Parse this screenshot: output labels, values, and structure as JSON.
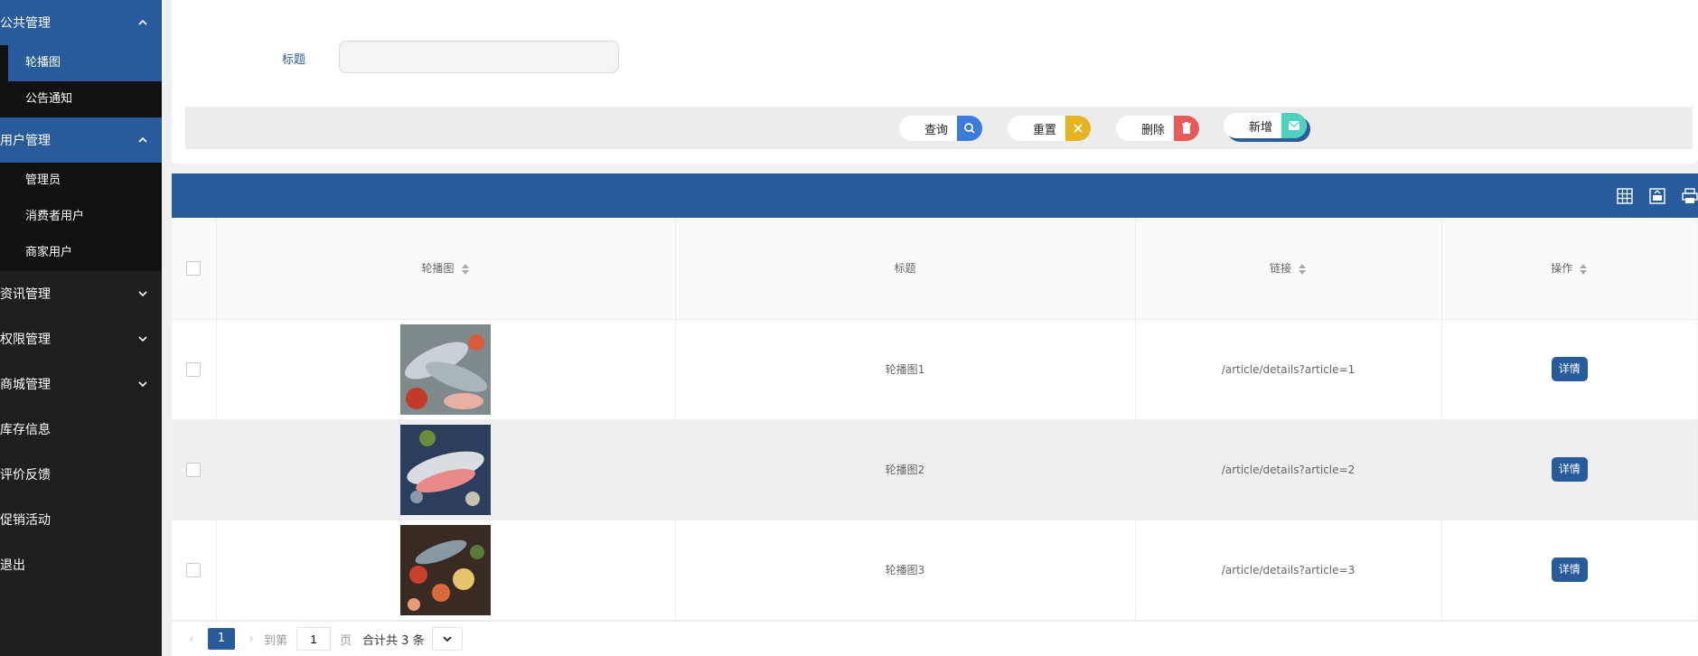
{
  "sidebar": {
    "groups": [
      {
        "label": "公共管理",
        "expanded": true,
        "items": [
          {
            "label": "轮播图"
          },
          {
            "label": "公告通知"
          }
        ]
      },
      {
        "label": "用户管理",
        "expanded": true,
        "items": [
          {
            "label": "管理员"
          },
          {
            "label": "消费者用户"
          },
          {
            "label": "商家用户"
          }
        ]
      },
      {
        "label": "资讯管理"
      },
      {
        "label": "权限管理"
      },
      {
        "label": "商城管理"
      },
      {
        "label": "库存信息"
      },
      {
        "label": "评价反馈"
      },
      {
        "label": "促销活动"
      },
      {
        "label": "退出"
      }
    ]
  },
  "search": {
    "label": "标题",
    "value": "",
    "placeholder": ""
  },
  "buttons": {
    "query": "查询",
    "reset": "重置",
    "delete": "删除",
    "add": "新增"
  },
  "colors": {
    "query": "#3a7bdc",
    "reset": "#e6b422",
    "delete": "#e85a5a",
    "add": "#4fd1c1",
    "brand": "#275b9b"
  },
  "table": {
    "headers": [
      "轮播图",
      "标题",
      "链接",
      "操作"
    ],
    "rows": [
      {
        "title": "轮播图1",
        "link": "/article/details?article=1",
        "action": "详情"
      },
      {
        "title": "轮播图2",
        "link": "/article/details?article=2",
        "action": "详情"
      },
      {
        "title": "轮播图3",
        "link": "/article/details?article=3",
        "action": "详情"
      }
    ]
  },
  "pager": {
    "current": "1",
    "goto": "到第",
    "page_input": "1",
    "page_unit": "页",
    "total": "合计共 3 条"
  }
}
